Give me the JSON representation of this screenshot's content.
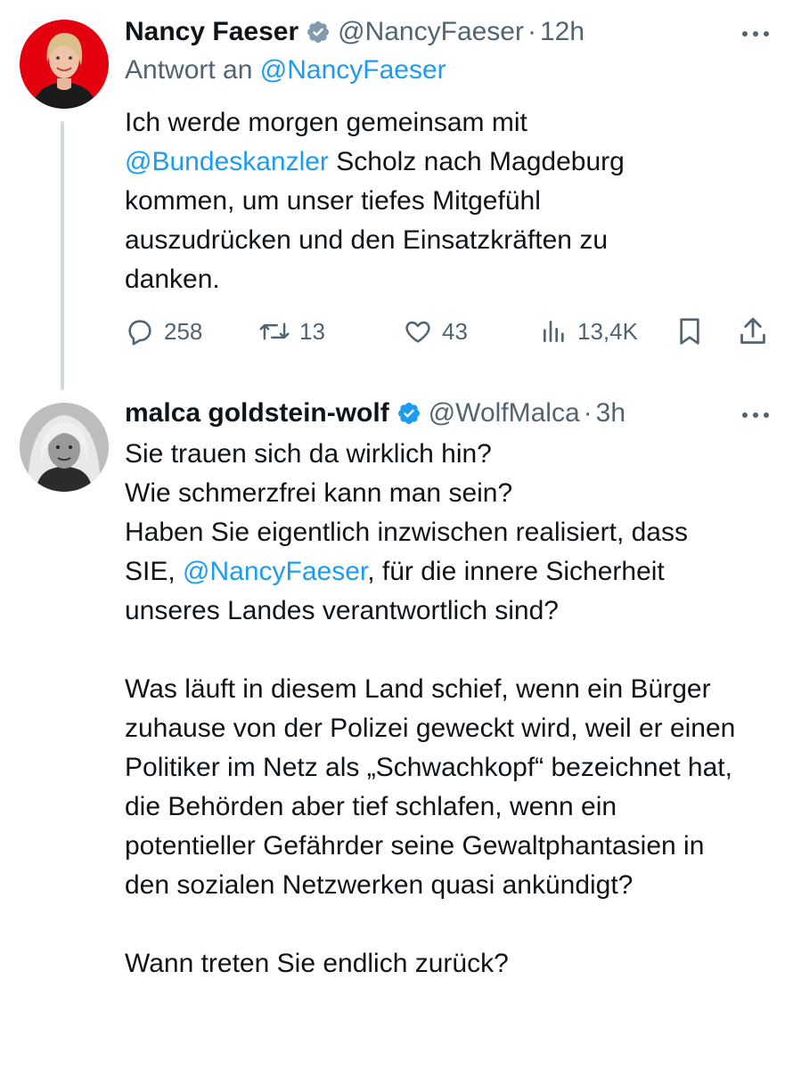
{
  "tweets": [
    {
      "display_name": "Nancy Faeser",
      "handle": "@NancyFaeser",
      "separator": "·",
      "time": "12h",
      "reply_to": {
        "prefix": "Antwort an",
        "handle": "@NancyFaeser"
      },
      "text": {
        "segment_1": "Ich werde morgen gemeinsam mit ",
        "mention": "@Bundeskanzler",
        "segment_2": " Scholz nach Magdeburg kommen, um unser tiefes Mitgefühl auszudrücken und den Einsatzkräften zu danken."
      },
      "stats": {
        "replies": "258",
        "reposts": "13",
        "likes": "43",
        "views": "13,4K"
      },
      "icons": [
        "verified-badge-icon",
        "more-icon",
        "reply-icon",
        "repost-icon",
        "like-icon",
        "views-icon",
        "bookmark-icon",
        "share-icon"
      ]
    },
    {
      "display_name": "malca goldstein-wolf",
      "handle": "@WolfMalca",
      "separator": "·",
      "time": "3h",
      "text": {
        "line_1": "Sie trauen sich da wirklich hin?",
        "line_2": "Wie schmerzfrei kann man sein?",
        "para_1_start": "Haben Sie eigentlich inzwischen realisiert, dass SIE, ",
        "mention": "@NancyFaeser",
        "para_1_end": ", für die innere Sicherheit unseres Landes verantwortlich sind?",
        "para_2": "Was läuft in diesem Land schief, wenn ein Bürger zuhause von der Polizei geweckt wird, weil er einen Politiker im Netz als „Schwachkopf“ bezeichnet hat, die Behörden aber tief schlafen, wenn ein potentieller Gefährder seine Gewaltphantasien in den sozialen Netzwerken quasi ankündigt?",
        "para_3": "Wann treten Sie endlich zurück?"
      },
      "icons": [
        "verified-badge-icon",
        "more-icon"
      ]
    }
  ],
  "colors": {
    "link": "#1d9bf0",
    "secondary_text": "#536471",
    "primary_text": "#0f1419",
    "thread_line": "#cfd9de",
    "avatar_1_bg": "#e3000f"
  }
}
